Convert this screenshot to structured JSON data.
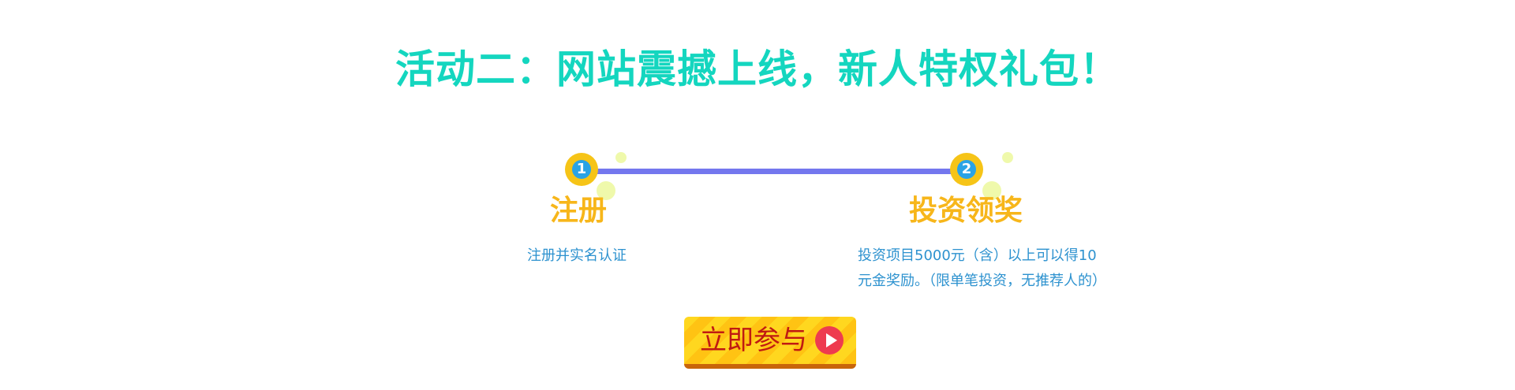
{
  "header": {
    "title": "活动二：网站震撼上线，新人特权礼包！"
  },
  "steps": [
    {
      "number": "1",
      "name": "注册",
      "description_lines": [
        "注册并实名认证"
      ]
    },
    {
      "number": "2",
      "name": "投资领奖",
      "description_lines": [
        "投资项目5000元（含）以上可以得10",
        "元金奖励。（限单笔投资，无推荐人的）"
      ]
    }
  ],
  "cta": {
    "label": "立即参与",
    "icon": "play-icon"
  },
  "colors": {
    "title": "#14d6bf",
    "connector": "#7477ee",
    "marker_ring": "#f6c417",
    "marker_inner": "#2aa3e6",
    "step_name": "#f7b61a",
    "description": "#2d92cf",
    "button_label": "#c01a12",
    "play_icon": "#ee3b4f"
  }
}
